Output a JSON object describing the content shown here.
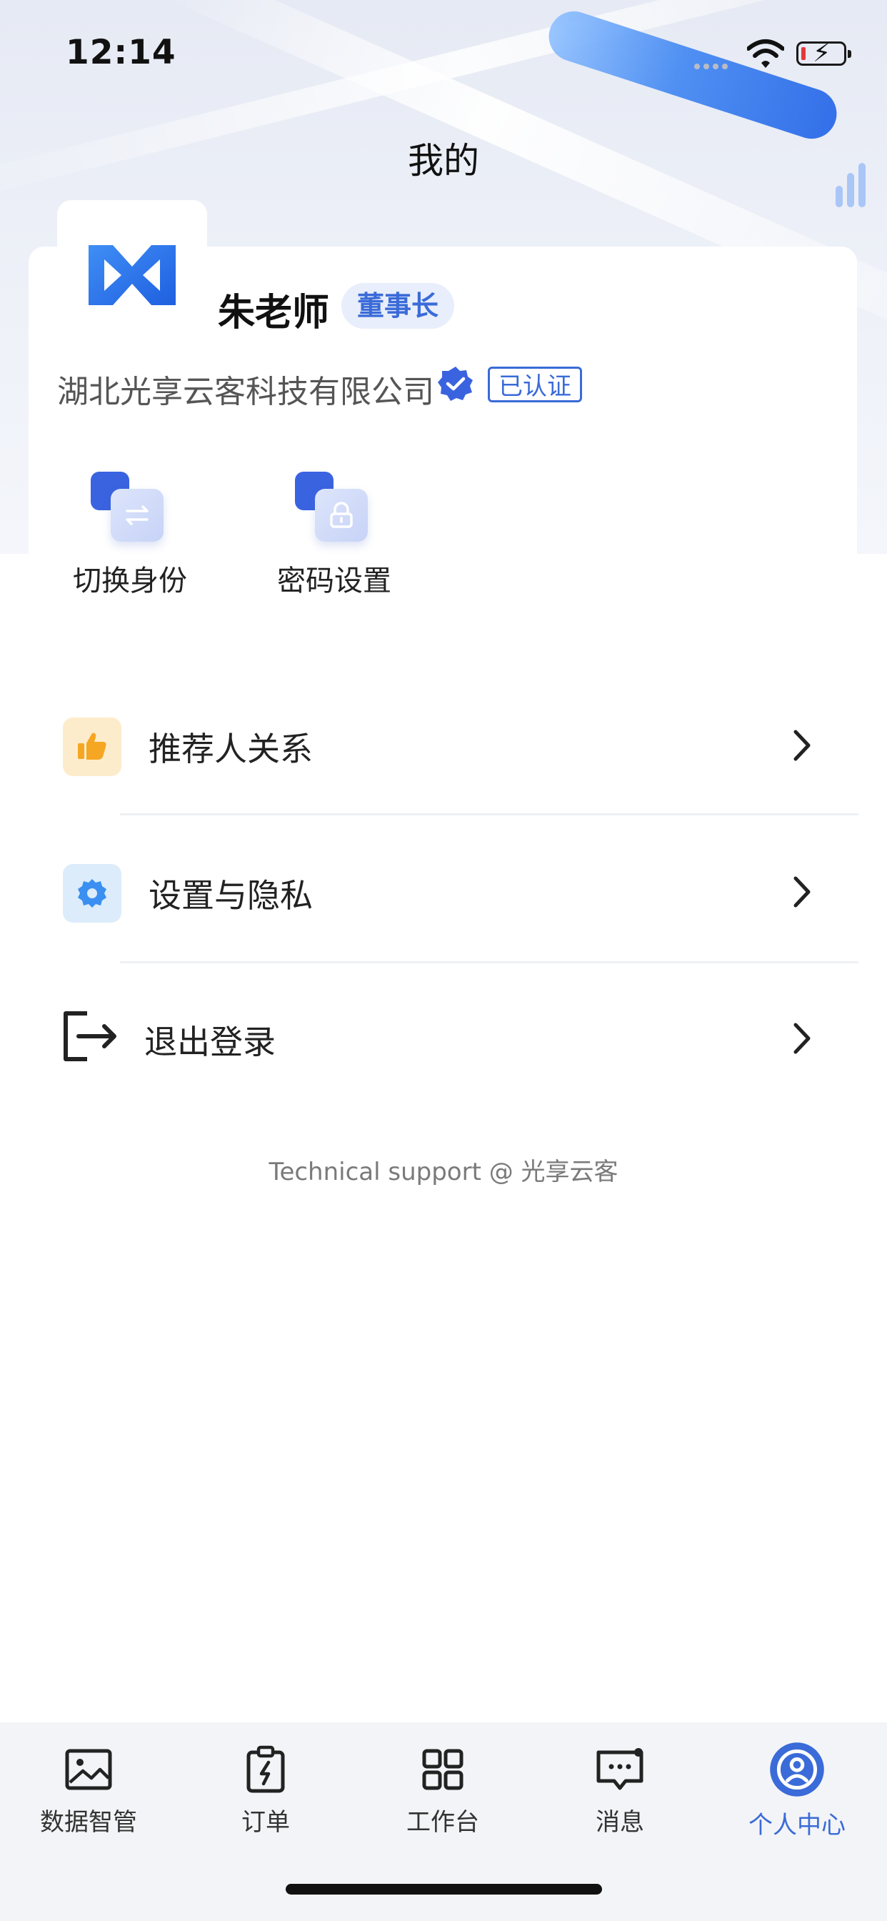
{
  "status_bar": {
    "time": "12:14"
  },
  "page": {
    "title": "我的"
  },
  "profile": {
    "name": "朱老师",
    "role": "董事长",
    "company": "湖北光享云客科技有限公司",
    "verified_label": "已认证"
  },
  "quick_actions": [
    {
      "label": "切换身份",
      "icon": "switch-arrows-icon"
    },
    {
      "label": "密码设置",
      "icon": "lock-icon"
    }
  ],
  "menu": [
    {
      "label": "推荐人关系",
      "icon": "thumbs-up-icon",
      "icon_color": "#f5a623",
      "icon_bg": "#fdeccb"
    },
    {
      "label": "设置与隐私",
      "icon": "gear-icon",
      "icon_color": "#3b8ff0",
      "icon_bg": "#dcecfb"
    },
    {
      "label": "退出登录",
      "icon": "logout-icon"
    }
  ],
  "footer": {
    "support_text": "Technical support @ 光享云客"
  },
  "tab_bar": {
    "active_color": "#3a6bd8",
    "tabs": [
      {
        "label": "数据智管",
        "icon": "image-chart-icon"
      },
      {
        "label": "订单",
        "icon": "clipboard-bolt-icon"
      },
      {
        "label": "工作台",
        "icon": "grid-icon"
      },
      {
        "label": "消息",
        "icon": "message-icon"
      },
      {
        "label": "个人中心",
        "icon": "user-circle-icon",
        "active": true
      }
    ]
  }
}
